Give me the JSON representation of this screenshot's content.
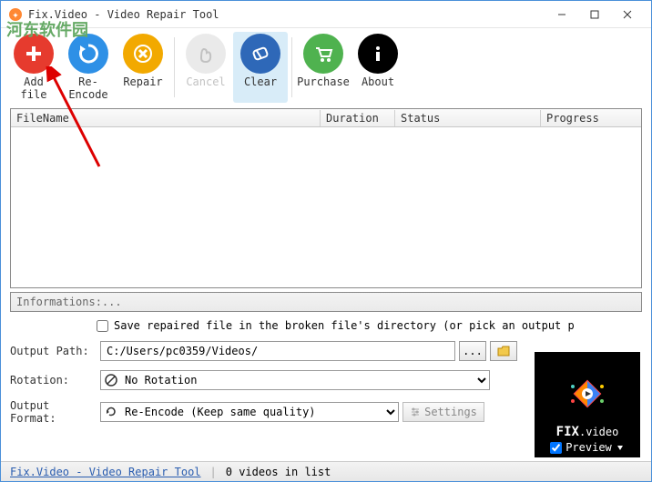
{
  "window": {
    "title": "Fix.Video - Video Repair Tool"
  },
  "watermark": "河东软件园",
  "toolbar": {
    "add_file": "Add file",
    "re_encode": "Re-Encode",
    "repair": "Repair",
    "cancel": "Cancel",
    "clear": "Clear",
    "purchase": "Purchase",
    "about": "About"
  },
  "columns": {
    "filename": "FileName",
    "duration": "Duration",
    "status": "Status",
    "progress": "Progress"
  },
  "info": {
    "label": "Informations: ",
    "value": "..."
  },
  "options": {
    "save_in_broken_label": "Save repaired file in the broken file's directory (or pick an output p",
    "output_path_label": "Output Path:",
    "output_path_value": "C:/Users/pc0359/Videos/",
    "rotation_label": "Rotation:",
    "rotation_value": "No Rotation",
    "output_format_label": "Output Format:",
    "output_format_value": "Re-Encode (Keep same quality)",
    "browse_ellipsis": "...",
    "settings_label": "Settings"
  },
  "preview": {
    "brand_top": "FIX",
    "brand_bottom": ".video",
    "label": "Preview"
  },
  "status": {
    "link": "Fix.Video - Video Repair Tool",
    "count": "0 videos in list"
  }
}
